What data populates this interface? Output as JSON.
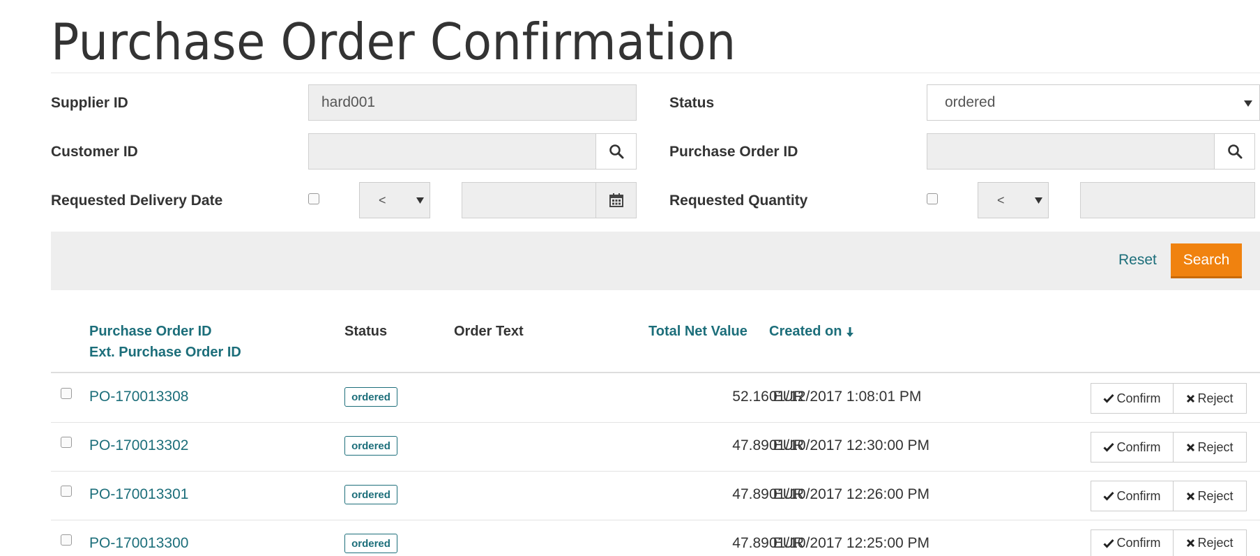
{
  "page_title": "Purchase Order Confirmation",
  "filters": {
    "supplier_id_label": "Supplier ID",
    "supplier_id_value": "hard001",
    "status_label": "Status",
    "status_value": "ordered",
    "customer_id_label": "Customer ID",
    "customer_id_value": "",
    "purchase_order_id_label": "Purchase Order ID",
    "purchase_order_id_value": "",
    "requested_delivery_date_label": "Requested Delivery Date",
    "requested_delivery_date_operator": "<",
    "requested_delivery_date_value": "",
    "requested_quantity_label": "Requested Quantity",
    "requested_quantity_operator": "<",
    "requested_quantity_value": ""
  },
  "toolbar": {
    "reset_label": "Reset",
    "search_label": "Search"
  },
  "table": {
    "headers": {
      "po_id": "Purchase Order ID",
      "ext_po_id": "Ext. Purchase Order ID",
      "status": "Status",
      "order_text": "Order Text",
      "total_net_value": "Total Net Value",
      "created_on": "Created on"
    },
    "rows": [
      {
        "po_id": "PO-170013308",
        "status": "ordered",
        "order_text": "",
        "total": "52.16 EUR",
        "created": "01/12/2017 1:08:01 PM",
        "confirm": "Confirm",
        "reject": "Reject"
      },
      {
        "po_id": "PO-170013302",
        "status": "ordered",
        "order_text": "",
        "total": "47.89 EUR",
        "created": "01/10/2017 12:30:00 PM",
        "confirm": "Confirm",
        "reject": "Reject"
      },
      {
        "po_id": "PO-170013301",
        "status": "ordered",
        "order_text": "",
        "total": "47.89 EUR",
        "created": "01/10/2017 12:26:00 PM",
        "confirm": "Confirm",
        "reject": "Reject"
      },
      {
        "po_id": "PO-170013300",
        "status": "ordered",
        "order_text": "",
        "total": "47.89 EUR",
        "created": "01/10/2017 12:25:00 PM",
        "confirm": "Confirm",
        "reject": "Reject"
      }
    ]
  },
  "icons": {
    "search": "search-icon",
    "calendar": "calendar-icon",
    "dropdown": "chevron-down-icon",
    "sort_desc": "sort-down-arrow-icon",
    "check": "check-icon",
    "times": "close-icon"
  },
  "colors": {
    "accent": "#1c6e7a",
    "primary_button": "#f0820f",
    "toolbar_bg": "#eeeeee"
  }
}
